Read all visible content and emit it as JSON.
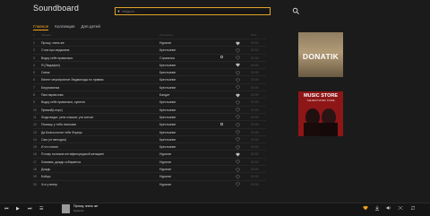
{
  "app": {
    "title": "Soundboard"
  },
  "search": {
    "placeholder": "Найдите..."
  },
  "tabs": [
    {
      "label": "Главное",
      "active": true
    },
    {
      "label": "Коллекция",
      "active": false
    },
    {
      "label": "Для детей",
      "active": false
    }
  ],
  "table": {
    "headers": {
      "num": "#",
      "title": "Название",
      "artist": "Исполнитель",
      "duration": "00:00"
    },
    "rows": [
      {
        "num": "1",
        "title": "Прошу, знать же",
        "artist": "Нуралат",
        "liked": true,
        "duration": "00:00"
      },
      {
        "num": "2",
        "title": "Стою про-ведьмина",
        "artist": "Крестьянин",
        "liked": false,
        "duration": "00:00"
      },
      {
        "num": "3",
        "title": "Водку себе правильно",
        "artist": "Страхалка",
        "liked": false,
        "duration": "00:00"
      },
      {
        "num": "4",
        "title": "Я (Людафил)",
        "artist": "Крестьянин",
        "liked": true,
        "duration": "00:00"
      },
      {
        "num": "5",
        "title": "Синяк",
        "artist": "Крестьянин",
        "liked": false,
        "duration": "00:00"
      },
      {
        "num": "6",
        "title": "Евгент мероприятие Людмилоды по привям",
        "artist": "Крестьянин",
        "liked": false,
        "duration": "00:00"
      },
      {
        "num": "7",
        "title": "Берусявилка",
        "artist": "Крестьянин",
        "liked": false,
        "duration": "00:00"
      },
      {
        "num": "8",
        "title": "Пам парам пам",
        "artist": "Бандит",
        "liked": true,
        "duration": "00:00"
      },
      {
        "num": "9",
        "title": "Водку себе правильно, купитес",
        "artist": "Крестьянин",
        "liked": false,
        "duration": "00:00"
      },
      {
        "num": "10",
        "title": "Прямой(Lнорс)",
        "artist": "Крестьянин",
        "liked": false,
        "duration": "00:00"
      },
      {
        "num": "11",
        "title": "Люди видят, ухни слышат, ути кончат",
        "artist": "Крестьянин",
        "liked": false,
        "duration": "00:00"
      },
      {
        "num": "12",
        "title": "Помощь у тебя личными",
        "artist": "Крестьянин",
        "liked": false,
        "duration": "00:00"
      },
      {
        "num": "13",
        "title": "Да Благослолит тебя Форнук",
        "artist": "Крестьянин",
        "liked": false,
        "duration": "00:00"
      },
      {
        "num": "14",
        "title": "Сам (от мелодия)",
        "artist": "Крестьянин",
        "liked": false,
        "duration": "00:00"
      },
      {
        "num": "15",
        "title": "И что понял",
        "artist": "Крестьянин",
        "liked": false,
        "duration": "00:00"
      },
      {
        "num": "16",
        "title": "Я кому положна литифильредской женщине",
        "artist": "Нуралат",
        "liked": true,
        "duration": "00:00"
      },
      {
        "num": "17",
        "title": "Ломовик, дождь собирается",
        "artist": "Нуралат",
        "liked": false,
        "duration": "00:00"
      },
      {
        "num": "18",
        "title": "Дождь",
        "artist": "Нуралат",
        "liked": false,
        "duration": "00:00"
      },
      {
        "num": "19",
        "title": "Бойцы",
        "artist": "Нуралат",
        "liked": false,
        "duration": "00:00"
      },
      {
        "num": "20",
        "title": "Что у ветер",
        "artist": "Нуралат",
        "liked": false,
        "duration": "00:00"
      }
    ]
  },
  "ads": [
    {
      "text": "DONATIK"
    },
    {
      "title": "MUSIC STORE",
      "subtitle": "THE BEST MUSIC STORE"
    }
  ],
  "player": {
    "now_title": "Прошу, знать же",
    "now_artist": "Нуралат",
    "progress": 0.0
  },
  "colors": {
    "accent": "#f0a21b",
    "bg": "#1b1b1b"
  }
}
